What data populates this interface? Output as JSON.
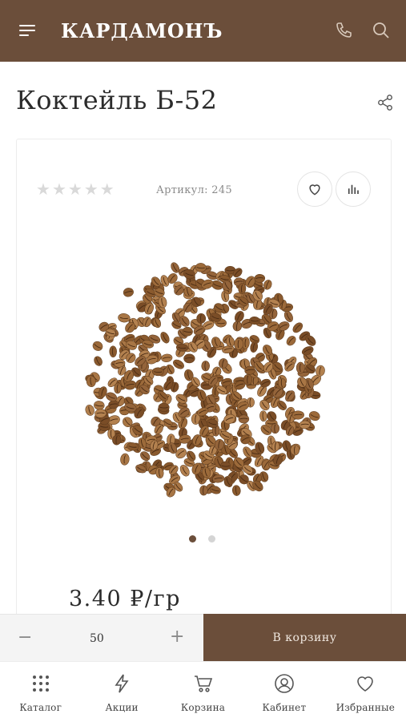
{
  "header": {
    "logo": "КАРДАМОНЪ",
    "icons": [
      "menu-icon",
      "phone-icon",
      "search-icon"
    ]
  },
  "product": {
    "title": "Коктейль Б-52",
    "rating": 0,
    "rating_max": 5,
    "sku_label": "Артикул: 245",
    "price": "3.40 ₽/гр",
    "image_dots": 2,
    "active_dot": 1
  },
  "cart": {
    "minus": "−",
    "quantity": "50",
    "plus": "+",
    "add_label": "В корзину"
  },
  "nav": {
    "items": [
      {
        "label": "Каталог",
        "icon": "grid-icon"
      },
      {
        "label": "Акции",
        "icon": "lightning-icon"
      },
      {
        "label": "Корзина",
        "icon": "cart-icon"
      },
      {
        "label": "Кабинет",
        "icon": "user-icon"
      },
      {
        "label": "Избранные",
        "icon": "heart-icon"
      }
    ]
  },
  "colors": {
    "brand": "#6b4e3a",
    "accent_text": "#f0e8e0"
  }
}
